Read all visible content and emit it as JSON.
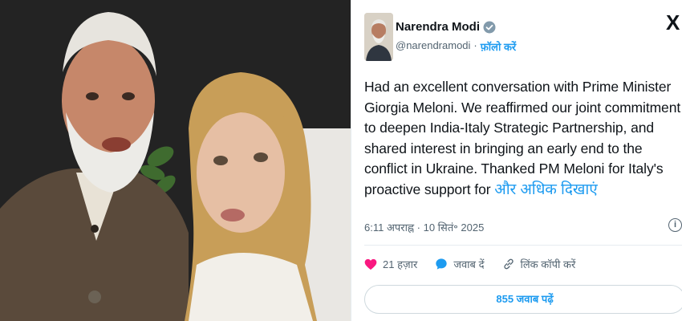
{
  "tweet": {
    "author_name": "Narendra Modi",
    "handle": "@narendramodi",
    "separator": "·",
    "follow_label": "फ़ॉलो करें",
    "x_logo": "X",
    "text": "Had an excellent conversation with Prime Minister Giorgia Meloni. We reaffirmed our joint commitment to deepen India-Italy Strategic Partnership, and shared interest in bringing an early end to the conflict in Ukraine. Thanked PM Meloni for Italy's proactive support for",
    "show_more": "और अधिक दिखाएं",
    "timestamp": "6:11 अपराह्न · 10 सितं॰ 2025",
    "info_icon": "i",
    "likes": "21 हज़ार",
    "reply_label": "जवाब दें",
    "copy_link_label": "लिंक कॉपी करें",
    "read_replies": "855 जवाब पढ़ें"
  },
  "icons": {
    "verified": "verified-badge-icon",
    "like": "heart-icon",
    "reply": "reply-bubble-icon",
    "link": "link-icon",
    "info": "info-icon"
  },
  "colors": {
    "accent": "#1d9bf0",
    "like": "#f91880",
    "text": "#0f1419",
    "muted": "#536471"
  }
}
